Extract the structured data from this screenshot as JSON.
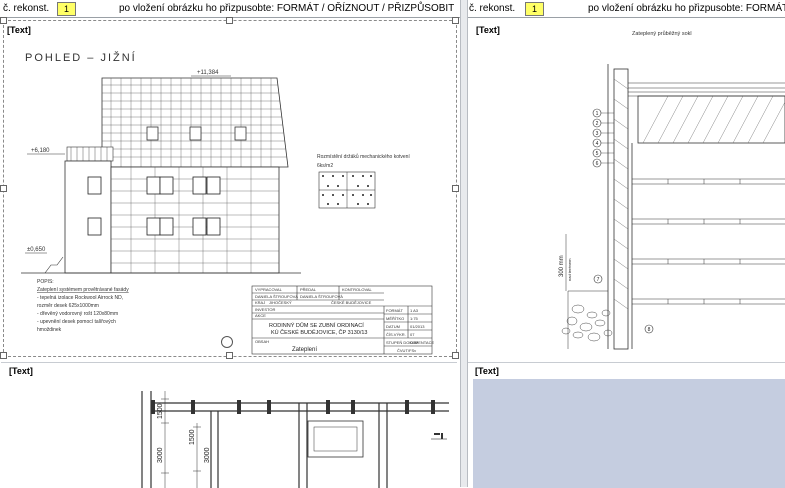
{
  "header_left": {
    "label": "č. rekonst.",
    "number": "1",
    "instruction": "po vložení obrázku ho přizpusobte: FORMÁT / OŘÍZNOUT / PŘIZPŮSOBIT"
  },
  "header_right": {
    "label": "č. rekonst.",
    "number": "1",
    "instruction": "po vložení obrázku ho přizpusobte: FORMÁT / OŘ"
  },
  "placeholders": {
    "top_left": "[Text]",
    "top_right": "[Text]",
    "bottom_left": "[Text]",
    "bottom_right": "[Text]"
  },
  "elevation": {
    "title": "POHLED – JIŽNÍ",
    "levels": {
      "top": "+11,384",
      "mid": "+6,180",
      "bottom": "±0,650"
    },
    "anchor_note": "Rozmístění držáků mechanického kotvení",
    "anchor_sub": "6ks/m2",
    "notes_title": "POPIS:",
    "notes": [
      "Zateplení systémem provětrávané fasády",
      "- tepelná izolace Rockwool Airrock ND,",
      "rozměr desek 625x1000mm",
      "- dřevěný vodorovný rošt 120x80mm",
      "- upevnění desek pomocí talířových",
      "hmoždinek"
    ],
    "stamp": {
      "row1": [
        "VYPRACOVAL",
        "PŘEDAL",
        "KONTROLOVAL"
      ],
      "row2": [
        "DANIELA ŠTROUFOVÁ",
        "DANIELA ŠTROUFOVÁ",
        ""
      ],
      "kraj": "KRAJ",
      "kraj_val": "JIHOČESKÝ",
      "mesto": "ČESKÉ BUDĚJOVICE",
      "investor": "INVESTOR",
      "akce": "AKCE",
      "title1": "RODINNÝ DŮM SE ZUBNÍ ORDINACÍ",
      "title2": "KÚ ČESKÉ BUDĚJOVICE, ČP 3130/13",
      "obsah": "OBSAH",
      "content": "Zateplení",
      "format": "FORMÁT",
      "format_val": "1 A3",
      "meritko": "MĚŘÍTKO",
      "meritko_val": "1:75",
      "datum": "DATUM",
      "datum_val": "01/2013",
      "cis": "ČÍS.VÝKR.",
      "cis_val": "07",
      "stupen": "STUPEŇ DOKUMENTACE",
      "stupen_val": "DSP",
      "cvut": "ČVUT/FSv"
    }
  },
  "detail": {
    "title": "Zateplený průběžný sokl",
    "numbers": [
      "1",
      "2",
      "3",
      "4",
      "5",
      "6"
    ],
    "marker7": "7",
    "marker8": "8",
    "dim": "300 mm",
    "dim_sub": "nad terénem"
  },
  "plan": {
    "dims": [
      "1500",
      "3000",
      "1500",
      "3000"
    ]
  }
}
